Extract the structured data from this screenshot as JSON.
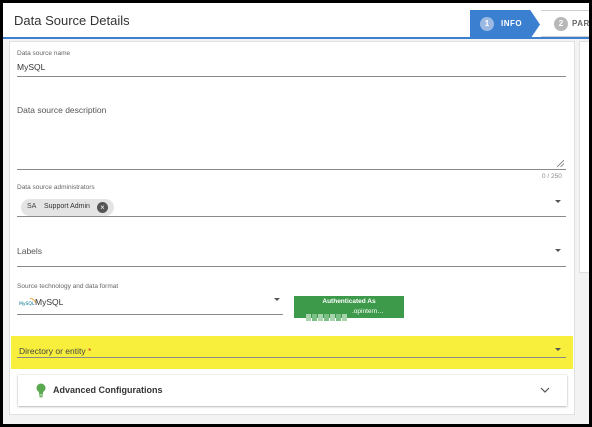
{
  "header": {
    "title": "Data Source Details",
    "steps": [
      {
        "number": "1",
        "label": "INFO",
        "active": true
      },
      {
        "number": "2",
        "label": "PARS",
        "active": false
      }
    ]
  },
  "form": {
    "name": {
      "label": "Data source name",
      "value": "MySQL"
    },
    "description": {
      "label": "Data source description",
      "counter": "0 / 250"
    },
    "administrators": {
      "label": "Data source administrators",
      "chip": {
        "avatar": "SA",
        "label": "Support Admin"
      }
    },
    "labels": {
      "label": "Labels"
    },
    "technology": {
      "label": "Source technology and data format",
      "logo_text": "MySQL",
      "value": "MySQL",
      "auth_title": "Authenticated As",
      "auth_user_suffix": ".opintern…"
    },
    "directory": {
      "label": "Directory or entity",
      "required_marker": "*",
      "highlighted": true
    },
    "advanced": {
      "label": "Advanced Configurations"
    }
  },
  "colors": {
    "accent": "#3b7fd1",
    "auth_button": "#3d9a4a",
    "highlight": "#f8ee3c",
    "bulb": "#5aa84f"
  },
  "icons": [
    "close-icon",
    "caret-down-icon",
    "resize-grip-icon",
    "mysql-logo",
    "lightbulb-icon",
    "chevron-down-icon"
  ]
}
